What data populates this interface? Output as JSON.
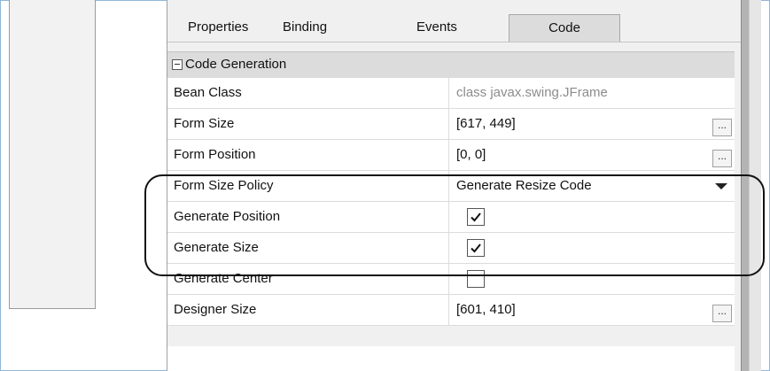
{
  "tabs": {
    "properties": "Properties",
    "binding": "Binding",
    "events": "Events",
    "code": "Code",
    "active": "Code"
  },
  "section": {
    "label": "Code Generation",
    "icon": "minus-icon"
  },
  "rows": [
    {
      "name": "Bean Class",
      "value": "class javax.swing.JFrame",
      "type": "readonly"
    },
    {
      "name": "Form Size",
      "value": "[617, 449]",
      "type": "ellipsis"
    },
    {
      "name": "Form Position",
      "value": "[0, 0]",
      "type": "ellipsis"
    },
    {
      "name": "Form Size Policy",
      "value": "Generate Resize Code",
      "type": "dropdown"
    },
    {
      "name": "Generate Position",
      "checked": true,
      "type": "checkbox"
    },
    {
      "name": "Generate Size",
      "checked": true,
      "type": "checkbox"
    },
    {
      "name": "Generate Center",
      "checked": false,
      "type": "checkbox"
    },
    {
      "name": "Designer Size",
      "value": "[601, 410]",
      "type": "ellipsis"
    }
  ],
  "ellipsis_label": "...",
  "colors": {
    "frame": "#8fb7d8",
    "readonly_text": "#8c8c8c",
    "highlight": "#111111"
  }
}
